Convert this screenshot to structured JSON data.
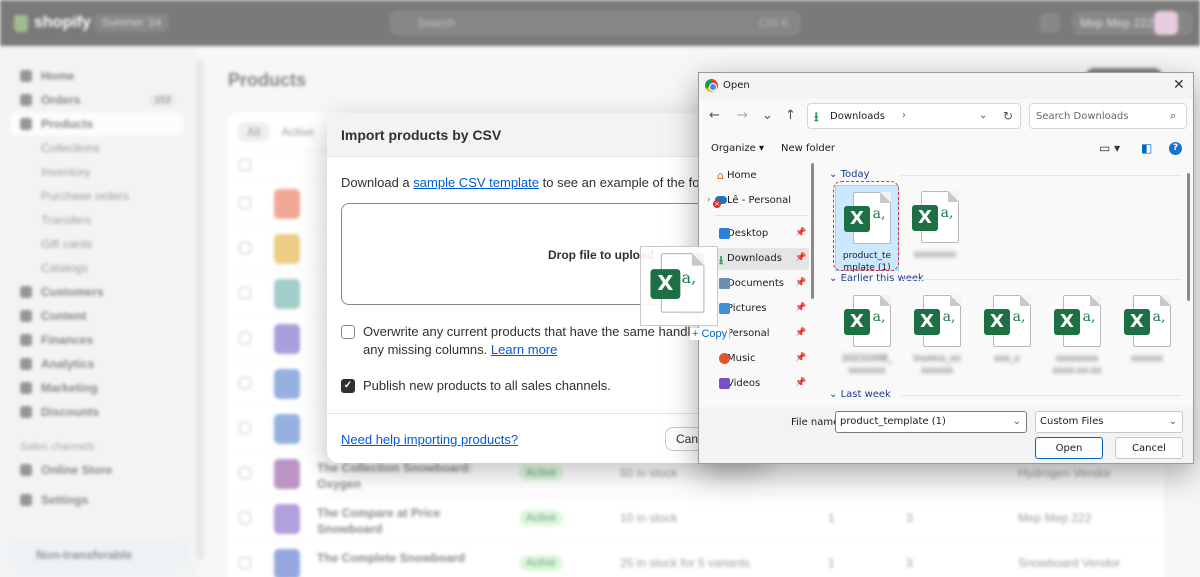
{
  "shopify": {
    "logo_text": "shopify",
    "store_name": "Summer '24",
    "search_placeholder": "Search",
    "search_shortcut": "Ctrl K",
    "user_name": "Mep Mep 222",
    "sidebar": {
      "items": [
        {
          "label": "Home"
        },
        {
          "label": "Orders",
          "badge": "152"
        },
        {
          "label": "Products"
        }
      ],
      "product_subitems": [
        "Collections",
        "Inventory",
        "Purchase orders",
        "Transfers",
        "Gift cards",
        "Catalogs"
      ],
      "more_items": [
        "Customers",
        "Content",
        "Finances",
        "Analytics",
        "Marketing",
        "Discounts"
      ],
      "sales_channels_label": "Sales channels",
      "channel_items": [
        "Online Store"
      ],
      "settings_label": "Settings",
      "bottom_label": "Non-transferable"
    },
    "page_title": "Products",
    "filter_tabs": [
      "All",
      "Active"
    ],
    "rows": [
      {
        "name": "",
        "status": "",
        "inventory": "",
        "n1": "",
        "n2": "",
        "vendor": ""
      },
      {
        "name": "",
        "status": "",
        "inventory": "",
        "n1": "",
        "n2": "",
        "vendor": ""
      },
      {
        "name": "",
        "status": "",
        "inventory": "",
        "n1": "",
        "n2": "",
        "vendor": ""
      },
      {
        "name": "",
        "status": "",
        "inventory": "",
        "n1": "",
        "n2": "",
        "vendor": ""
      },
      {
        "name": "",
        "status": "",
        "inventory": "",
        "n1": "",
        "n2": "",
        "vendor": ""
      },
      {
        "name": "",
        "status": "",
        "inventory": "",
        "n1": "",
        "n2": "",
        "vendor": ""
      },
      {
        "name": "The Collection Snowboard: Oxygen",
        "status": "Active",
        "inventory": "50 in stock",
        "n1": "",
        "n2": "",
        "vendor": "Hydrogen Vendor"
      },
      {
        "name": "The Compare at Price Snowboard",
        "status": "Active",
        "inventory": "10 in stock",
        "n1": "1",
        "n2": "3",
        "vendor": "Mep Mep 222"
      },
      {
        "name": "The Complete Snowboard",
        "status": "Active",
        "inventory": "25 in stock for 5 variants",
        "n1": "1",
        "n2": "3",
        "vendor": "Snowboard Vendor"
      }
    ]
  },
  "import_modal": {
    "title": "Import products by CSV",
    "desc_prefix": "Download a ",
    "desc_link": "sample CSV template",
    "desc_suffix": " to see an example of the format r",
    "dropzone_label": "Drop file to upload",
    "overwrite_text_1": "Overwrite any current products that have the same handle. Ex",
    "overwrite_text_2": "any missing columns. ",
    "learn_more": "Learn more",
    "overwrite_checked": false,
    "publish_text": "Publish new products to all sales channels.",
    "publish_checked": true,
    "help_link": "Need help importing products?",
    "cancel_label": "Canc"
  },
  "drag": {
    "copy_label": "+ Copy",
    "badge": "X",
    "glyph": "a,"
  },
  "open_dialog": {
    "title": "Open",
    "close_glyph": "✕",
    "nav": {
      "back": "←",
      "forward": "→",
      "recent": "⌄",
      "up": "↑"
    },
    "address": {
      "folder": "Downloads",
      "sep": "›",
      "dropdown": "⌄",
      "refresh": "↻"
    },
    "search_placeholder": "Search Downloads",
    "search_icon": "⌕",
    "toolbar": {
      "organize": "Organize ▾",
      "new_folder": "New folder",
      "view_glyph": "▭ ▾",
      "pane_glyph": "◧",
      "help": "?"
    },
    "nav_pane": [
      {
        "label": "Home",
        "icon": "home-icon"
      },
      {
        "label": "Lê - Personal",
        "icon": "onedrive-icon"
      },
      {
        "label": "Desktop",
        "icon": "desktop-icon",
        "pinned": true
      },
      {
        "label": "Downloads",
        "icon": "downloads-icon",
        "pinned": true,
        "selected": true
      },
      {
        "label": "Documents",
        "icon": "documents-icon",
        "pinned": true
      },
      {
        "label": "Pictures",
        "icon": "pictures-icon",
        "pinned": true
      },
      {
        "label": "Personal",
        "icon": "folder-icon",
        "pinned": true
      },
      {
        "label": "Music",
        "icon": "music-icon",
        "pinned": true
      },
      {
        "label": "Videos",
        "icon": "videos-icon",
        "pinned": true
      }
    ],
    "groups": {
      "today": "Today",
      "earlier": "Earlier this week",
      "last_week": "Last week"
    },
    "files_today": [
      {
        "name_1": "product_te",
        "name_2": "mplate (1)",
        "selected": true
      },
      {
        "name_1": "xxxxxxxx",
        "name_2": "",
        "blurred": true
      }
    ],
    "files_earlier": [
      {
        "name_1": "20231008_",
        "name_2": "xxxxxxx",
        "blurred": true
      },
      {
        "name_1": "invoice_xx",
        "name_2": "xxxxxx",
        "blurred": true
      },
      {
        "name_1": "xxx_x",
        "name_2": "",
        "blurred": true
      },
      {
        "name_1": "xxxxxxxx",
        "name_2": "xxxx-xx-xx",
        "blurred": true
      },
      {
        "name_1": "xxxxxx",
        "name_2": "",
        "blurred": true
      }
    ],
    "file_name_label": "File name:",
    "file_name_value": "product_template (1)",
    "file_type_value": "Custom Files",
    "open_label": "Open",
    "cancel_label": "Cancel"
  }
}
